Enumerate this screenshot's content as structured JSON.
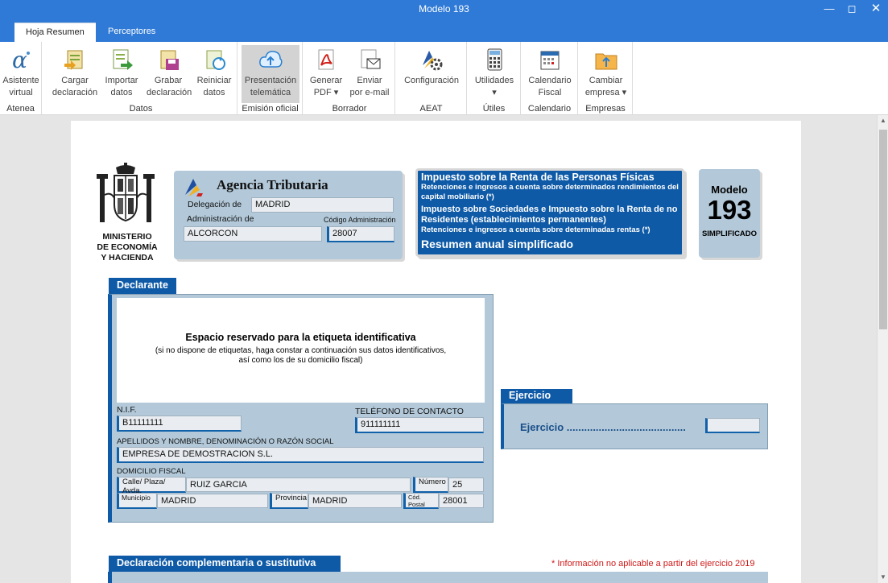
{
  "window": {
    "title": "Modelo 193"
  },
  "tabs": [
    {
      "label": "Hoja Resumen"
    },
    {
      "label": "Perceptores"
    }
  ],
  "ribbon": {
    "groups": [
      {
        "label": "Atenea",
        "buttons": [
          {
            "label": "Asistente\nvirtual",
            "icon": "atenea-alpha-icon"
          }
        ]
      },
      {
        "label": "Datos",
        "buttons": [
          {
            "label": "Cargar\ndeclaración",
            "icon": "load-declaration-icon"
          },
          {
            "label": "Importar\ndatos",
            "icon": "import-data-icon"
          },
          {
            "label": "Grabar\ndeclaración",
            "icon": "save-declaration-icon"
          },
          {
            "label": "Reiniciar\ndatos",
            "icon": "reset-data-icon"
          }
        ]
      },
      {
        "label": "Emisión oficial",
        "buttons": [
          {
            "label": "Presentación\ntelemática",
            "icon": "cloud-upload-icon",
            "selected": true
          }
        ]
      },
      {
        "label": "Borrador",
        "buttons": [
          {
            "label": "Generar\nPDF ▾",
            "icon": "pdf-icon"
          },
          {
            "label": "Enviar\npor e-mail",
            "icon": "email-icon"
          }
        ]
      },
      {
        "label": "AEAT",
        "buttons": [
          {
            "label": "Configuración",
            "icon": "configuration-icon"
          }
        ]
      },
      {
        "label": "Útiles",
        "buttons": [
          {
            "label": "Utilidades\n▾",
            "icon": "calculator-icon"
          }
        ]
      },
      {
        "label": "Calendario",
        "buttons": [
          {
            "label": "Calendario\nFiscal",
            "icon": "calendar-icon"
          }
        ]
      },
      {
        "label": "Empresas",
        "buttons": [
          {
            "label": "Cambiar\nempresa ▾",
            "icon": "folder-icon"
          }
        ]
      }
    ]
  },
  "form": {
    "ministry": "MINISTERIO\nDE ECONOMÍA\nY HACIENDA",
    "agency": {
      "name": "Agencia Tributaria",
      "delegacion_label": "Delegación de",
      "delegacion_value": "MADRID",
      "administracion_label": "Administración de",
      "codigo_label": "Código Administración",
      "administracion_value": "ALCORCON",
      "codigo_value": "28007"
    },
    "tax_box": {
      "title": "Impuesto sobre la Renta de las Personas Físicas",
      "line1": "Retenciones e ingresos a cuenta sobre determinados rendimientos del capital mobiliario (*)",
      "title2": "Impuesto sobre Sociedades e Impuesto sobre la Renta de no Residentes (establecimientos permanentes)",
      "line2": "Retenciones e ingresos a cuenta sobre determinadas rentas (*)",
      "summary": "Resumen anual simplificado"
    },
    "modelo": {
      "label": "Modelo",
      "number": "193",
      "type": "SIMPLIFICADO"
    },
    "declarante": {
      "tab": "Declarante",
      "reserved_title": "Espacio reservado para la etiqueta identificativa",
      "reserved_note": "(si no dispone de etiquetas, haga constar a continuación sus datos identificativos,\nasí como los de su domicilio fiscal)",
      "nif_label": "N.I.F.",
      "nif_value": "B11111111",
      "phone_label": "TELÉFONO DE CONTACTO",
      "phone_value": "911111111",
      "name_label": "APELLIDOS Y NOMBRE, DENOMINACIÓN O RAZÓN SOCIAL",
      "name_value": "EMPRESA DE DEMOSTRACION S.L.",
      "domicile_label": "DOMICILIO FISCAL",
      "street_label": "Calle/ Plaza/ Avda.",
      "street_value": "RUIZ GARCIA",
      "number_label": "Número",
      "number_value": "25",
      "municipio_label": "Municipio",
      "municipio_value": "MADRID",
      "provincia_label": "Provincia",
      "provincia_value": "MADRID",
      "postal_label": "Cód. Postal",
      "postal_value": "28001"
    },
    "ejercicio": {
      "tab": "Ejercicio",
      "label": "Ejercicio .........................................",
      "value": ""
    },
    "complementaria": {
      "tab": "Declaración complementaria o sustitutiva",
      "note": "* Información no aplicable a partir del ejercicio 2019"
    }
  }
}
